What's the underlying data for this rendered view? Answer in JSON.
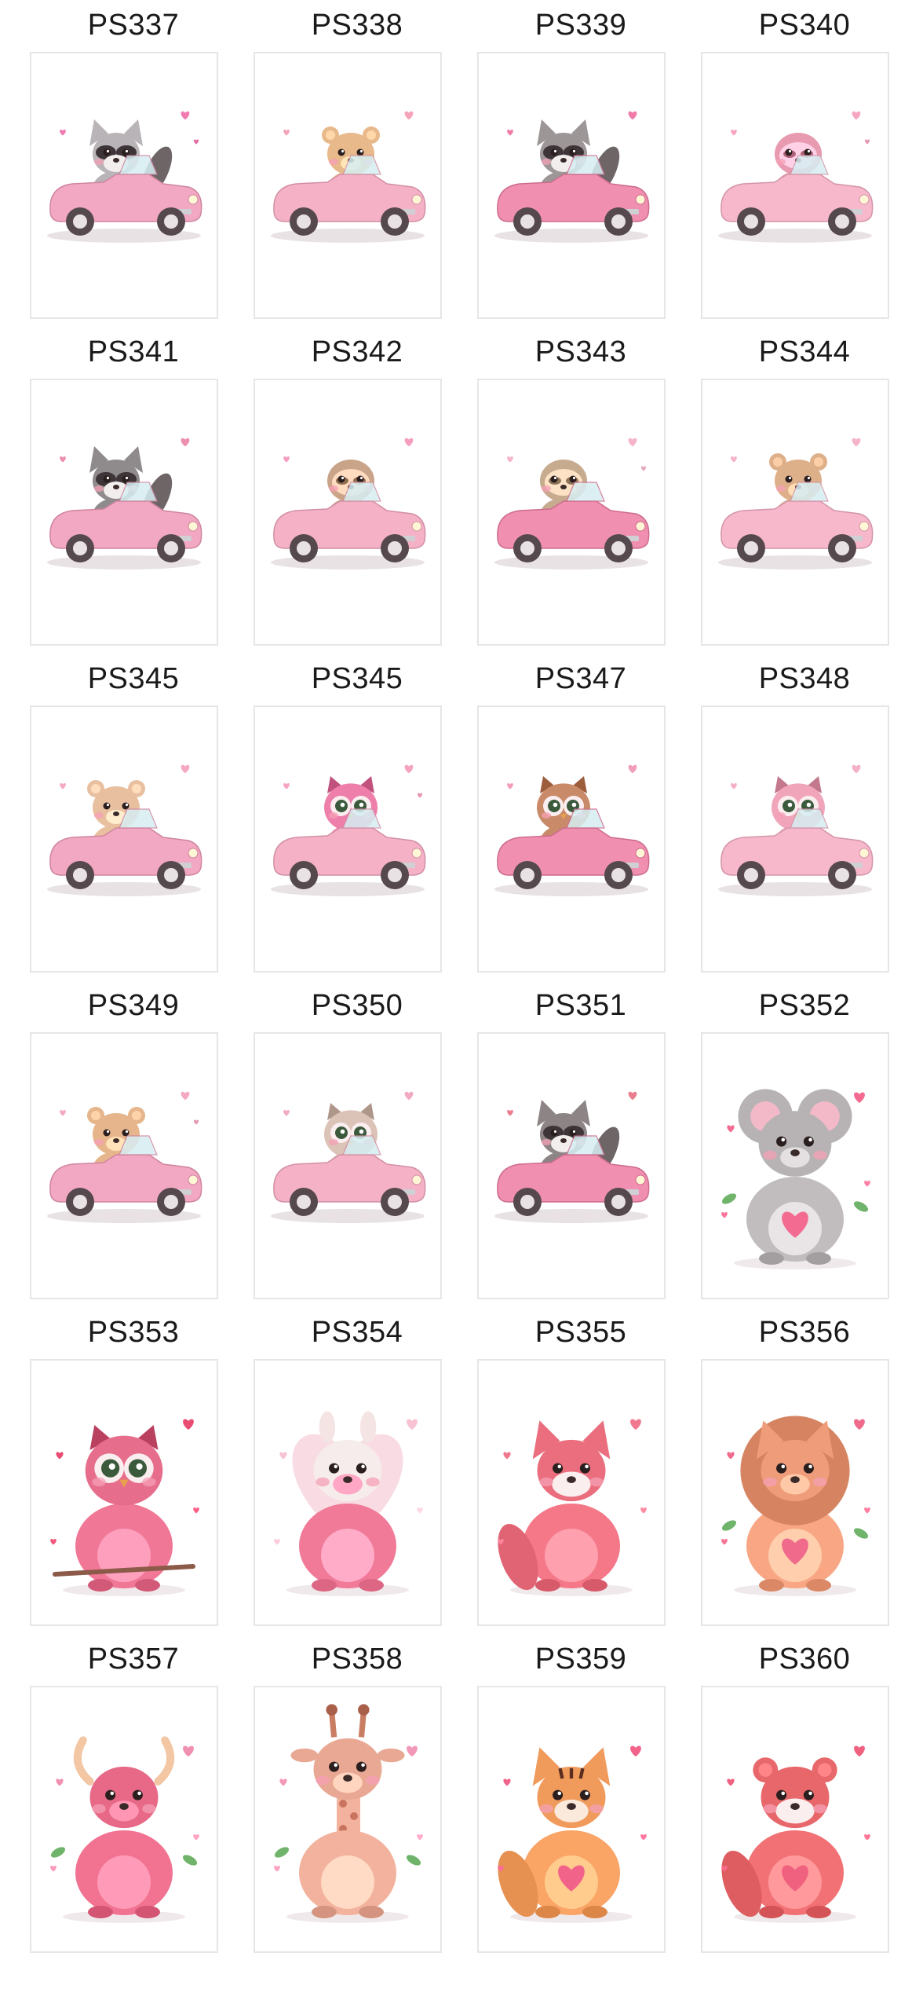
{
  "products": [
    {
      "code": "PS337",
      "animal": "raccoon",
      "scene": "car",
      "fur": "#b8b4b8",
      "accent": "#f07bb0"
    },
    {
      "code": "PS338",
      "animal": "bear",
      "scene": "car",
      "fur": "#e8b98a",
      "accent": "#f4a3b8"
    },
    {
      "code": "PS339",
      "animal": "raccoon",
      "scene": "car",
      "fur": "#9d9697",
      "accent": "#f07ba6"
    },
    {
      "code": "PS340",
      "animal": "sloth",
      "scene": "car",
      "fur": "#e89ab0",
      "accent": "#f5a7c0"
    },
    {
      "code": "PS341",
      "animal": "raccoon",
      "scene": "car",
      "fur": "#8f8a8c",
      "accent": "#ec8fb0"
    },
    {
      "code": "PS342",
      "animal": "sloth",
      "scene": "car",
      "fur": "#c9a488",
      "accent": "#f59ec0"
    },
    {
      "code": "PS343",
      "animal": "sloth",
      "scene": "car",
      "fur": "#c7ab8f",
      "accent": "#f5b5c9"
    },
    {
      "code": "PS344",
      "animal": "bear",
      "scene": "car",
      "fur": "#deb08a",
      "accent": "#f4b3c6"
    },
    {
      "code": "PS345",
      "animal": "bear",
      "scene": "car",
      "fur": "#e8c0a0",
      "accent": "#f5a9c3"
    },
    {
      "code": "PS345",
      "animal": "owl",
      "scene": "car",
      "fur": "#ee7eaa",
      "accent": "#f6a2c2"
    },
    {
      "code": "PS347",
      "animal": "owl",
      "scene": "car",
      "fur": "#c98a6a",
      "accent": "#f29eb9"
    },
    {
      "code": "PS348",
      "animal": "owl",
      "scene": "car",
      "fur": "#f0a5bb",
      "accent": "#f4b0c4"
    },
    {
      "code": "PS349",
      "animal": "bear",
      "scene": "car",
      "fur": "#e6b58b",
      "accent": "#f5aac1"
    },
    {
      "code": "PS350",
      "animal": "owl",
      "scene": "car",
      "fur": "#dcc3b7",
      "accent": "#f2a9c2"
    },
    {
      "code": "PS351",
      "animal": "raccoon",
      "scene": "car",
      "fur": "#8d8485",
      "accent": "#ea7e8f"
    },
    {
      "code": "PS352",
      "animal": "koala",
      "scene": "portrait",
      "fur": "#b7b3b4",
      "accent": "#f36b90"
    },
    {
      "code": "PS353",
      "animal": "owl",
      "scene": "portrait",
      "fur": "#e66d8c",
      "accent": "#ea4d73"
    },
    {
      "code": "PS354",
      "animal": "llama",
      "scene": "portrait",
      "fur": "#f07a97",
      "accent": "#f7c3d3"
    },
    {
      "code": "PS355",
      "animal": "fox",
      "scene": "portrait",
      "fur": "#ea6e7d",
      "accent": "#f0788f"
    },
    {
      "code": "PS356",
      "animal": "lion",
      "scene": "portrait",
      "fur": "#ee9c7a",
      "accent": "#f06a8c"
    },
    {
      "code": "PS357",
      "animal": "yak",
      "scene": "portrait",
      "fur": "#e76987",
      "accent": "#f08fb0"
    },
    {
      "code": "PS358",
      "animal": "giraffe",
      "scene": "portrait",
      "fur": "#e9a893",
      "accent": "#f398b8"
    },
    {
      "code": "PS359",
      "animal": "tiger",
      "scene": "portrait",
      "fur": "#f09a5c",
      "accent": "#f2638a"
    },
    {
      "code": "PS360",
      "animal": "red-panda",
      "scene": "portrait",
      "fur": "#e7676a",
      "accent": "#f0607f"
    }
  ]
}
